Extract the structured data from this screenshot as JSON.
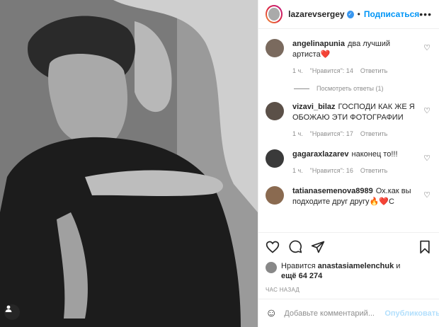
{
  "header": {
    "username": "lazarevsergey",
    "separator": "•",
    "follow_label": "Подписаться",
    "more_icon": "more-horizontal-icon"
  },
  "comments": [
    {
      "user": "angelinapunia",
      "text": "два лучший артиста❤️",
      "time": "1 ч.",
      "likes": "\"Нравится\": 14",
      "reply": "Ответить",
      "avatar_color": "#7a6a5e",
      "view_replies": "Посмотреть ответы (1)"
    },
    {
      "user": "vizavi_bilaz",
      "text": "ГОСПОДИ КАК ЖЕ Я ОБОЖАЮ ЭТИ ФОТОГРАФИИ",
      "time": "1 ч.",
      "likes": "\"Нравится\": 17",
      "reply": "Ответить",
      "avatar_color": "#5b5048"
    },
    {
      "user": "gagaraxlazarev",
      "text": "наконец то!!!",
      "time": "1 ч.",
      "likes": "\"Нравится\": 16",
      "reply": "Ответить",
      "avatar_color": "#3a3a3a"
    },
    {
      "user": "tatianasemenova8989",
      "text": "Ох.как вы подходите друг другу🔥❤️С",
      "avatar_color": "#8a6a50"
    }
  ],
  "likes": {
    "prefix": "Нравится",
    "user": "anastasiamelenchuk",
    "conj": "и",
    "others": "ещё 64 274"
  },
  "time_ago": "ЧАС НАЗАД",
  "add_comment": {
    "placeholder": "Добавьте комментарий...",
    "publish_label": "Опубликовать"
  },
  "colors": {
    "accent": "#0095f6",
    "verified": "#3897f0",
    "muted": "#8e8e8e",
    "heart": "#ed4956"
  }
}
